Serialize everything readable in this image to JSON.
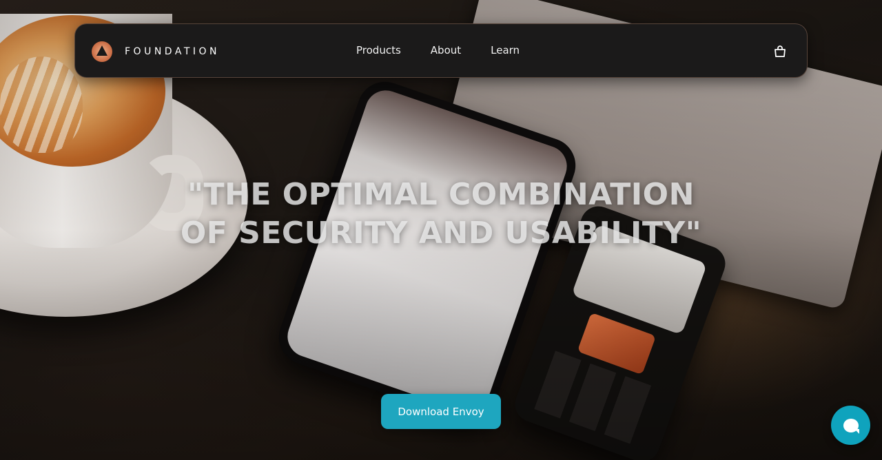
{
  "brand": {
    "name": "FOUNDATION",
    "logo_icon": "foundation-logo-icon"
  },
  "nav": {
    "items": [
      {
        "label": "Products"
      },
      {
        "label": "About"
      },
      {
        "label": "Learn"
      }
    ],
    "cart_icon": "shopping-bag-icon"
  },
  "hero": {
    "headline_line1": "\"THE OPTIMAL COMBINATION",
    "headline_line2": "OF SECURITY AND USABILITY\"",
    "cta_label": "Download Envoy"
  },
  "chat": {
    "icon": "chat-bubble-icon"
  },
  "colors": {
    "accent": "#1ea6bf",
    "navbar_bg": "#1b1a1a",
    "chat_bg": "#0fa3bd",
    "logo_accent": "#c96a42"
  }
}
